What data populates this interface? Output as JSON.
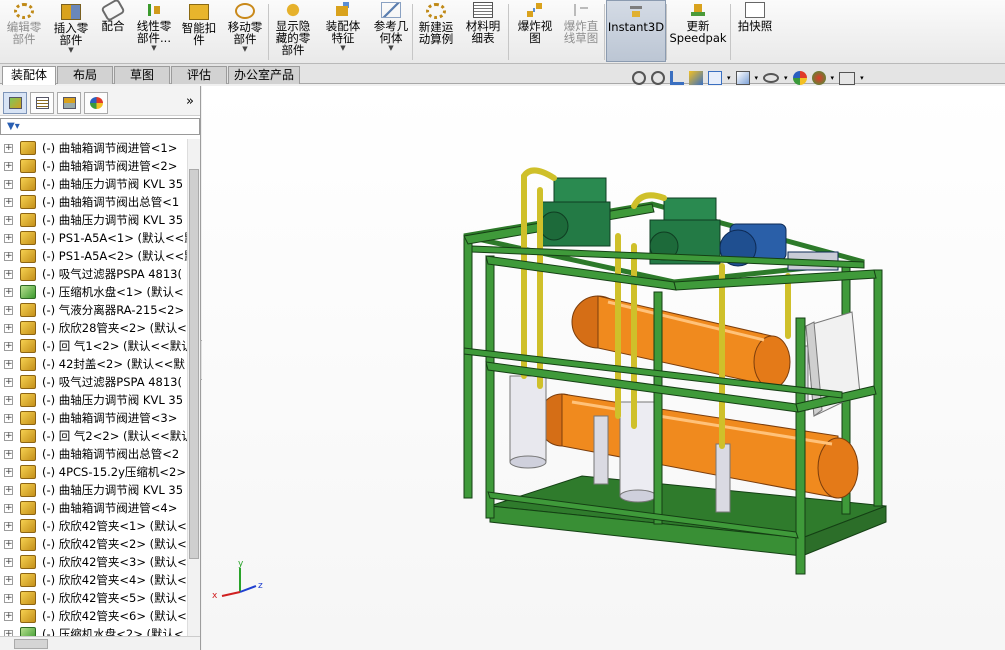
{
  "toolbar": {
    "buttons": [
      {
        "label": "编辑零\n部件",
        "icon": "edit-part-icon",
        "disabled": true,
        "arrow": false
      },
      {
        "label": "插入零\n部件",
        "icon": "insert-component-icon",
        "disabled": false,
        "arrow": true
      },
      {
        "label": "配合",
        "icon": "mate-icon",
        "disabled": false,
        "arrow": false
      },
      {
        "label": "线性零\n部件...",
        "icon": "linear-pattern-icon",
        "disabled": false,
        "arrow": true
      },
      {
        "label": "智能扣\n件",
        "icon": "smart-fastener-icon",
        "disabled": false,
        "arrow": false
      },
      {
        "label": "移动零\n部件",
        "icon": "move-component-icon",
        "disabled": false,
        "arrow": true
      },
      {
        "label": "显示隐\n藏的零\n部件",
        "icon": "show-hidden-icon",
        "disabled": false,
        "arrow": false
      },
      {
        "label": "装配体\n特征",
        "icon": "assembly-feature-icon",
        "disabled": false,
        "arrow": true
      },
      {
        "label": "参考几\n何体",
        "icon": "reference-geometry-icon",
        "disabled": false,
        "arrow": true
      },
      {
        "label": "新建运\n动算例",
        "icon": "new-motion-study-icon",
        "disabled": false,
        "arrow": false
      },
      {
        "label": "材料明\n细表",
        "icon": "bill-of-materials-icon",
        "disabled": false,
        "arrow": false
      },
      {
        "label": "爆炸视\n图",
        "icon": "exploded-view-icon",
        "disabled": false,
        "arrow": false
      },
      {
        "label": "爆炸直\n线草图",
        "icon": "explode-line-sketch-icon",
        "disabled": true,
        "arrow": false
      },
      {
        "label": "Instant3D",
        "icon": "instant3d-icon",
        "disabled": false,
        "arrow": false,
        "active": true
      },
      {
        "label": "更新\nSpeedpak",
        "icon": "update-speedpak-icon",
        "disabled": false,
        "arrow": false
      },
      {
        "label": "拍快照",
        "icon": "take-snapshot-icon",
        "disabled": false,
        "arrow": false
      }
    ]
  },
  "tabs": [
    "装配体",
    "布局",
    "草图",
    "评估",
    "办公室产品"
  ],
  "tree": {
    "items": [
      {
        "text": "(-) 曲轴箱调节阀进管<1>",
        "color": "yellow"
      },
      {
        "text": "(-) 曲轴箱调节阀进管<2>",
        "color": "yellow"
      },
      {
        "text": "(-) 曲轴压力调节阀 KVL 35",
        "color": "yellow"
      },
      {
        "text": "(-) 曲轴箱调节阀出总管<1",
        "color": "yellow"
      },
      {
        "text": "(-) 曲轴压力调节阀 KVL 35",
        "color": "yellow"
      },
      {
        "text": "(-) PS1-A5A<1> (默认<<默",
        "color": "yellow"
      },
      {
        "text": "(-) PS1-A5A<2> (默认<<默",
        "color": "yellow"
      },
      {
        "text": "(-) 吸气过滤器PSPA 4813(",
        "color": "yellow"
      },
      {
        "text": "(-) 压缩机水盘<1> (默认<",
        "color": "green"
      },
      {
        "text": "(-) 气液分离器RA-215<2>",
        "color": "yellow"
      },
      {
        "text": "(-) 欣欣28管夹<2> (默认<",
        "color": "yellow"
      },
      {
        "text": "(-) 回 气1<2> (默认<<默认",
        "color": "yellow"
      },
      {
        "text": "(-) 42封盖<2> (默认<<默",
        "color": "yellow"
      },
      {
        "text": "(-) 吸气过滤器PSPA 4813(",
        "color": "yellow"
      },
      {
        "text": "(-) 曲轴压力调节阀 KVL 35",
        "color": "yellow"
      },
      {
        "text": "(-) 曲轴箱调节阀进管<3>",
        "color": "yellow"
      },
      {
        "text": "(-) 回 气2<2> (默认<<默认",
        "color": "yellow"
      },
      {
        "text": "(-) 曲轴箱调节阀出总管<2",
        "color": "yellow"
      },
      {
        "text": "(-) 4PCS-15.2y压缩机<2>",
        "color": "yellow"
      },
      {
        "text": "(-) 曲轴压力调节阀 KVL 35",
        "color": "yellow"
      },
      {
        "text": "(-) 曲轴箱调节阀进管<4>",
        "color": "yellow"
      },
      {
        "text": "(-) 欣欣42管夹<1> (默认<",
        "color": "yellow"
      },
      {
        "text": "(-) 欣欣42管夹<2> (默认<",
        "color": "yellow"
      },
      {
        "text": "(-) 欣欣42管夹<3> (默认<",
        "color": "yellow"
      },
      {
        "text": "(-) 欣欣42管夹<4> (默认<",
        "color": "yellow"
      },
      {
        "text": "(-) 欣欣42管夹<5> (默认<",
        "color": "yellow"
      },
      {
        "text": "(-) 欣欣42管夹<6> (默认<",
        "color": "yellow"
      },
      {
        "text": "(-) 压缩机水盘<2> (默认<",
        "color": "green"
      }
    ]
  },
  "triad": {
    "x": "x",
    "y": "y",
    "z": "z"
  },
  "colors": {
    "frame": "#3f9a3a",
    "vessel": "#f08a1e",
    "compressor": "#2a8a50",
    "motor": "#2a5fa8",
    "pipe": "#e7d43a"
  }
}
